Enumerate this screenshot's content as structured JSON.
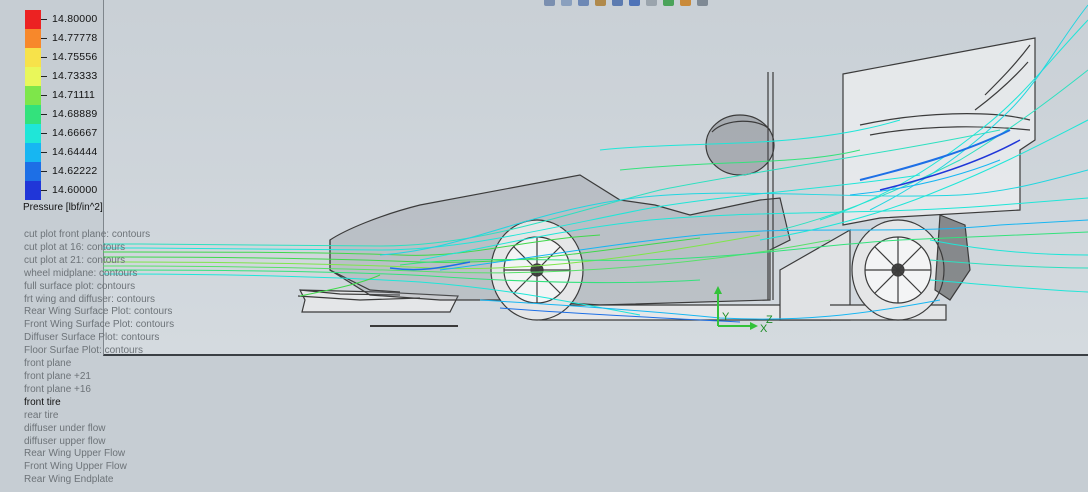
{
  "legend": {
    "title": "Pressure [lbf/in^2]",
    "entries": [
      {
        "value": "14.80000",
        "color": "#ec2222"
      },
      {
        "value": "14.77778",
        "color": "#f7882b"
      },
      {
        "value": "14.75556",
        "color": "#f7e24a"
      },
      {
        "value": "14.73333",
        "color": "#e9f75a"
      },
      {
        "value": "14.71111",
        "color": "#7ee64a"
      },
      {
        "value": "14.68889",
        "color": "#33e27c"
      },
      {
        "value": "14.66667",
        "color": "#1fe6d8"
      },
      {
        "value": "14.64444",
        "color": "#17b6f2"
      },
      {
        "value": "14.62222",
        "color": "#1d6fe6"
      },
      {
        "value": "14.60000",
        "color": "#2036d8"
      }
    ]
  },
  "tree": {
    "items": [
      {
        "label": "cut plot front plane: contours",
        "selected": false
      },
      {
        "label": "cut plot at 16: contours",
        "selected": false
      },
      {
        "label": "cut plot at 21: contours",
        "selected": false
      },
      {
        "label": "wheel midplane: contours",
        "selected": false
      },
      {
        "label": "full surface plot: contours",
        "selected": false
      },
      {
        "label": "frt wing and diffuser: contours",
        "selected": false
      },
      {
        "label": "Rear Wing Surface Plot: contours",
        "selected": false
      },
      {
        "label": "Front Wing Surface Plot: contours",
        "selected": false
      },
      {
        "label": "Diffuser Surface Plot: contours",
        "selected": false
      },
      {
        "label": "Floor Surfae Plot: contours",
        "selected": false
      },
      {
        "label": "front plane",
        "selected": false
      },
      {
        "label": "front plane +21",
        "selected": false
      },
      {
        "label": "front plane +16",
        "selected": false
      },
      {
        "label": "front tire",
        "selected": true
      },
      {
        "label": "rear tire",
        "selected": false
      },
      {
        "label": "diffuser under flow",
        "selected": false
      },
      {
        "label": "diffuser upper flow",
        "selected": false
      },
      {
        "label": "Rear Wing Upper Flow",
        "selected": false
      },
      {
        "label": "Front Wing Upper Flow",
        "selected": false
      },
      {
        "label": "Rear Wing Endplate",
        "selected": false
      }
    ]
  },
  "toolbar": {
    "icons": [
      "zoom-to-fit-icon",
      "zoom-area-icon",
      "previous-view-icon",
      "section-view-icon",
      "view-orientation-icon",
      "display-style-icon",
      "hide-show-icon",
      "edit-appearance-icon",
      "apply-scene-icon",
      "view-settings-icon"
    ]
  },
  "triad": {
    "x_label": "X",
    "y_label": "Y",
    "z_label": "Z"
  },
  "colors": {
    "viewport_bg": "#cdd3d9",
    "panel_bg": "#c6cdd3",
    "body_outline": "#3b3b3b"
  }
}
